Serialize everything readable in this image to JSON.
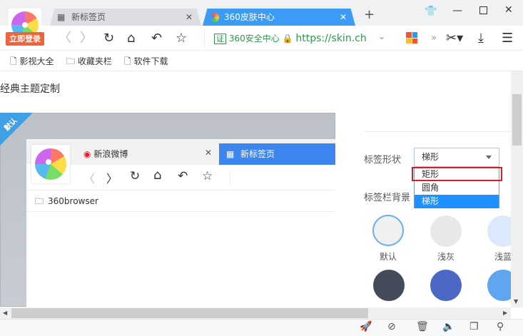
{
  "tabs": [
    {
      "label": "新标签页",
      "icon": "grid-icon"
    },
    {
      "label": "360皮肤中心",
      "icon": "360-icon",
      "active": true
    }
  ],
  "login_label": "立即登录",
  "address": {
    "cert": "证",
    "site_label": "360安全中心",
    "url": "https://skin.ch"
  },
  "bookmarks": [
    {
      "label": "影视大全",
      "icon": "page-icon"
    },
    {
      "label": "收藏夹栏",
      "icon": "folder-icon"
    },
    {
      "label": "软件下载",
      "icon": "page-icon"
    }
  ],
  "heading": "经典主题定制",
  "preview": {
    "ribbon": "默认",
    "tabs": [
      {
        "label": "新浪微博"
      },
      {
        "label": "新标签页"
      }
    ],
    "bookmark": "360browser"
  },
  "settings": {
    "tab_shape_label": "标签形状",
    "tab_shape_value": "梯形",
    "options": [
      "矩形",
      "圆角",
      "梯形"
    ],
    "selected_option": "梯形",
    "highlighted_option": "矩形",
    "tabbar_bg_label": "标签栏背景",
    "swatches": [
      {
        "label": "默认",
        "color": "#f0f0f0"
      },
      {
        "label": "浅灰",
        "color": "#e8e8e8"
      },
      {
        "label": "浅蓝",
        "color": "#dce8fb"
      },
      {
        "color": "#434b59"
      },
      {
        "color": "#4a68c4"
      },
      {
        "color": "#5fa5f0"
      }
    ]
  }
}
